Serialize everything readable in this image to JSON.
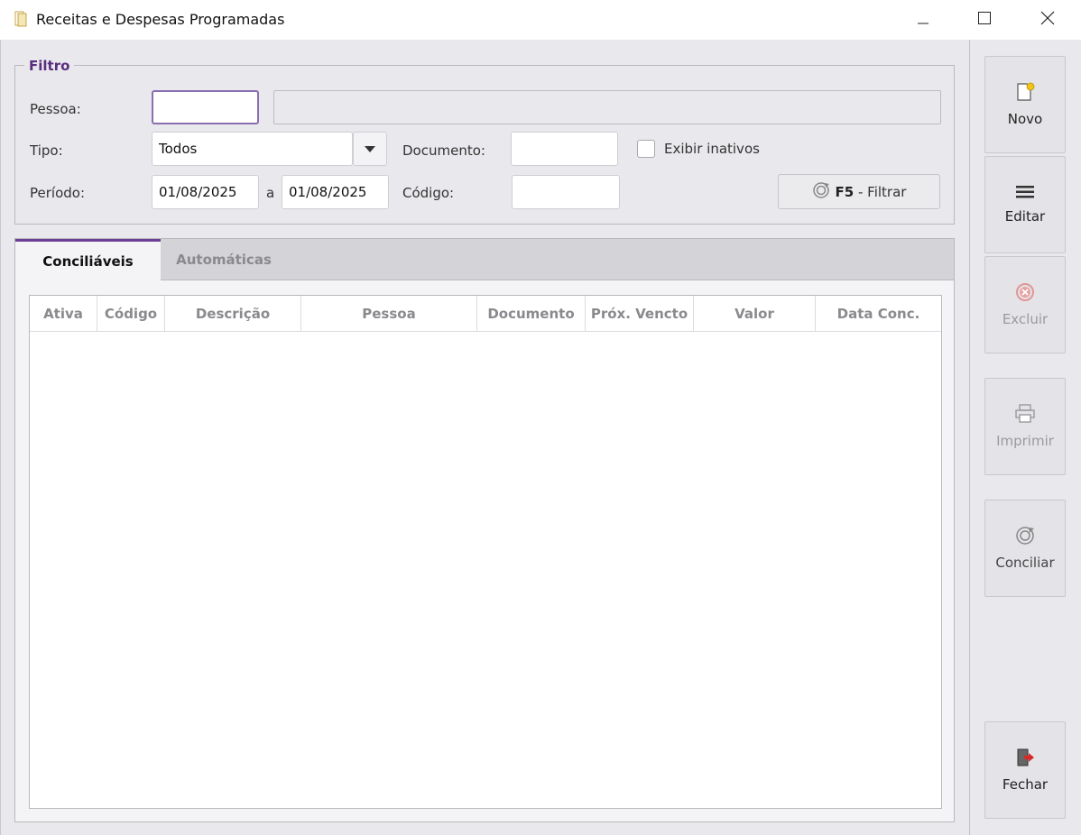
{
  "window": {
    "title": "Receitas e Despesas Programadas",
    "app_icon": "document-icon",
    "controls": [
      "minimize-icon",
      "maximize-icon",
      "close-icon"
    ]
  },
  "filter": {
    "legend": "Filtro",
    "pessoa_label": "Pessoa:",
    "pessoa_code_value": "",
    "pessoa_name_value": "",
    "tipo_label": "Tipo:",
    "tipo_value": "Todos",
    "documento_label": "Documento:",
    "documento_value": "",
    "exibir_inativos_label": "Exibir inativos",
    "exibir_inativos_checked": false,
    "periodo_label": "Período:",
    "periodo_from": "01/08/2025",
    "periodo_sep": "a",
    "periodo_to": "01/08/2025",
    "codigo_label": "Código:",
    "codigo_value": "",
    "filter_button_key": "F5",
    "filter_button_text": " - Filtrar",
    "accent_color": "#5a2d7e"
  },
  "tabs": [
    {
      "label": "Conciliáveis",
      "active": true
    },
    {
      "label": "Automáticas",
      "active": false
    }
  ],
  "grid": {
    "columns": [
      "Ativa",
      "Código",
      "Descrição",
      "Pessoa",
      "Documento",
      "Próx. Vencto",
      "Valor",
      "Data Conc."
    ],
    "rows": []
  },
  "toolbar": {
    "novo": {
      "label": "Novo",
      "icon": "new-document-icon",
      "enabled": true
    },
    "editar": {
      "label": "Editar",
      "icon": "menu-lines-icon",
      "enabled": true
    },
    "excluir": {
      "label": "Excluir",
      "icon": "delete-circle-icon",
      "enabled": false
    },
    "imprimir": {
      "label": "Imprimir",
      "icon": "printer-icon",
      "enabled": false
    },
    "conciliar": {
      "label": "Conciliar",
      "icon": "reconcile-icon",
      "enabled": false
    },
    "fechar": {
      "label": "Fechar",
      "icon": "exit-door-icon",
      "enabled": true
    }
  }
}
